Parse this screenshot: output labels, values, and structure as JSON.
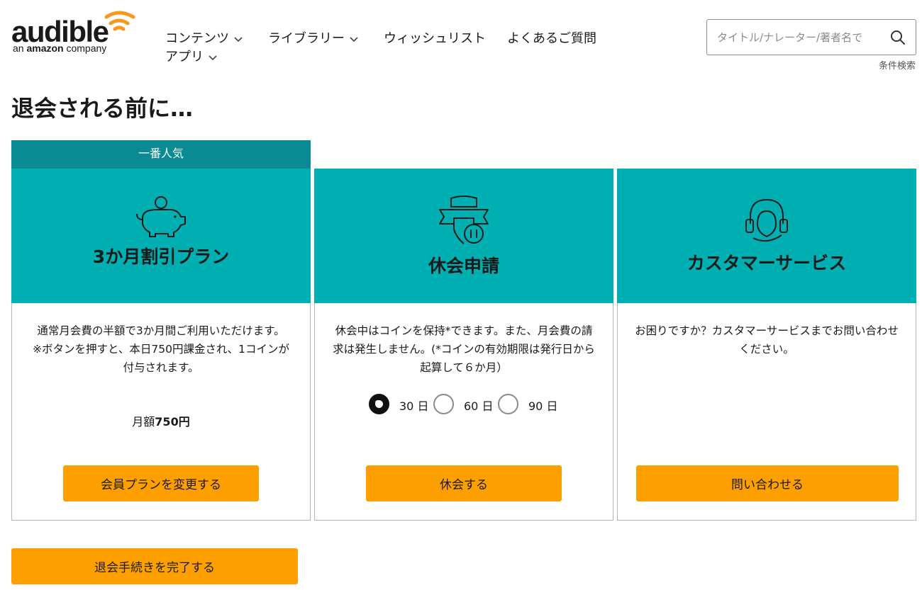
{
  "logo": {
    "word": "audible",
    "sub_prefix": "an ",
    "sub_brand": "amazon",
    "sub_suffix": " company"
  },
  "nav": {
    "contents": "コンテンツ",
    "library": "ライブラリー",
    "wishlist": "ウィッシュリスト",
    "faq": "よくあるご質問",
    "apps": "アプリ"
  },
  "search": {
    "placeholder": "タイトル/ナレーター/著者名で",
    "advanced": "条件検索"
  },
  "page_title": "退会される前に…",
  "cards": [
    {
      "badge": "一番人気",
      "title": "3か月割引プラン",
      "description": "通常月会費の半額で3か月間ご利用いただけます。\n※ボタンを押すと、本日750円課金され、1コインが付与されます。",
      "price_label": "月額",
      "price_value": "750円",
      "button": "会員プランを変更する",
      "icon": "piggy-bank-icon"
    },
    {
      "title": "休会申請",
      "description": "休会中はコインを保持*できます。また、月会費の請求は発生しません。(*コインの有効期限は発行日から起算して６か月）",
      "options": [
        "30 日",
        "60 日",
        "90 日"
      ],
      "selected": "30 日",
      "button": "休会する",
      "icon": "pause-badge-icon"
    },
    {
      "title": "カスタマーサービス",
      "description": "お困りですか？カスタマーサービスまでお問い合わせください。",
      "button": "問い合わせる",
      "icon": "headset-icon"
    }
  ],
  "final_button": "退会手続きを完了する",
  "colors": {
    "teal": "#00afb2",
    "teal_dark": "#0a8a93",
    "orange": "#fe9f00",
    "logo_orange": "#f7991c"
  }
}
